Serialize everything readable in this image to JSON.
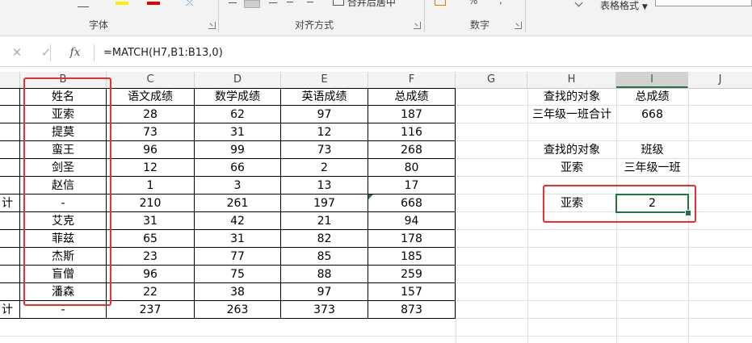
{
  "ribbon": {
    "group_font": "字体",
    "group_align": "对齐方式",
    "group_number": "数字",
    "table_format": "表格格式",
    "merge_center_partial": "合并后居中",
    "percent_symbol": "%"
  },
  "formula_bar": {
    "cancel_glyph": "✕",
    "confirm_glyph": "✓",
    "fx_label": "fx",
    "formula": "=MATCH(H7,B1:B13,0)"
  },
  "columns": [
    "B",
    "C",
    "D",
    "E",
    "F",
    "G",
    "H",
    "I",
    "J"
  ],
  "selected_column": "I",
  "table": {
    "headers": [
      "姓名",
      "语文成绩",
      "数学成绩",
      "英语成绩",
      "总成绩"
    ],
    "rows": [
      {
        "a": "",
        "b": "亚索",
        "c": "28",
        "d": "62",
        "e": "97",
        "f": "187"
      },
      {
        "a": "",
        "b": "提莫",
        "c": "73",
        "d": "31",
        "e": "12",
        "f": "116"
      },
      {
        "a": "",
        "b": "蛮王",
        "c": "96",
        "d": "99",
        "e": "73",
        "f": "268"
      },
      {
        "a": "",
        "b": "剑圣",
        "c": "12",
        "d": "66",
        "e": "2",
        "f": "80"
      },
      {
        "a": "",
        "b": "赵信",
        "c": "1",
        "d": "3",
        "e": "13",
        "f": "17"
      },
      {
        "a": "计",
        "b": "-",
        "c": "210",
        "d": "261",
        "e": "197",
        "f": "668"
      },
      {
        "a": "",
        "b": "艾克",
        "c": "31",
        "d": "42",
        "e": "21",
        "f": "94"
      },
      {
        "a": "",
        "b": "菲兹",
        "c": "65",
        "d": "31",
        "e": "82",
        "f": "178"
      },
      {
        "a": "",
        "b": "杰斯",
        "c": "23",
        "d": "77",
        "e": "85",
        "f": "185"
      },
      {
        "a": "",
        "b": "盲僧",
        "c": "96",
        "d": "75",
        "e": "88",
        "f": "259"
      },
      {
        "a": "",
        "b": "潘森",
        "c": "22",
        "d": "38",
        "e": "97",
        "f": "157"
      },
      {
        "a": "计",
        "b": "-",
        "c": "237",
        "d": "263",
        "e": "373",
        "f": "873"
      }
    ]
  },
  "lookup": {
    "h1": "查找的对象",
    "i1": "总成绩",
    "h2": "三年级一班合计",
    "i2": "668",
    "h4": "查找的对象",
    "i4": "班级",
    "h5": "亚索",
    "i5": "三年级一班",
    "h7": "亚索",
    "i7": "2"
  },
  "colors": {
    "accent_green": "#217346",
    "highlight_red": "#e8312f"
  }
}
